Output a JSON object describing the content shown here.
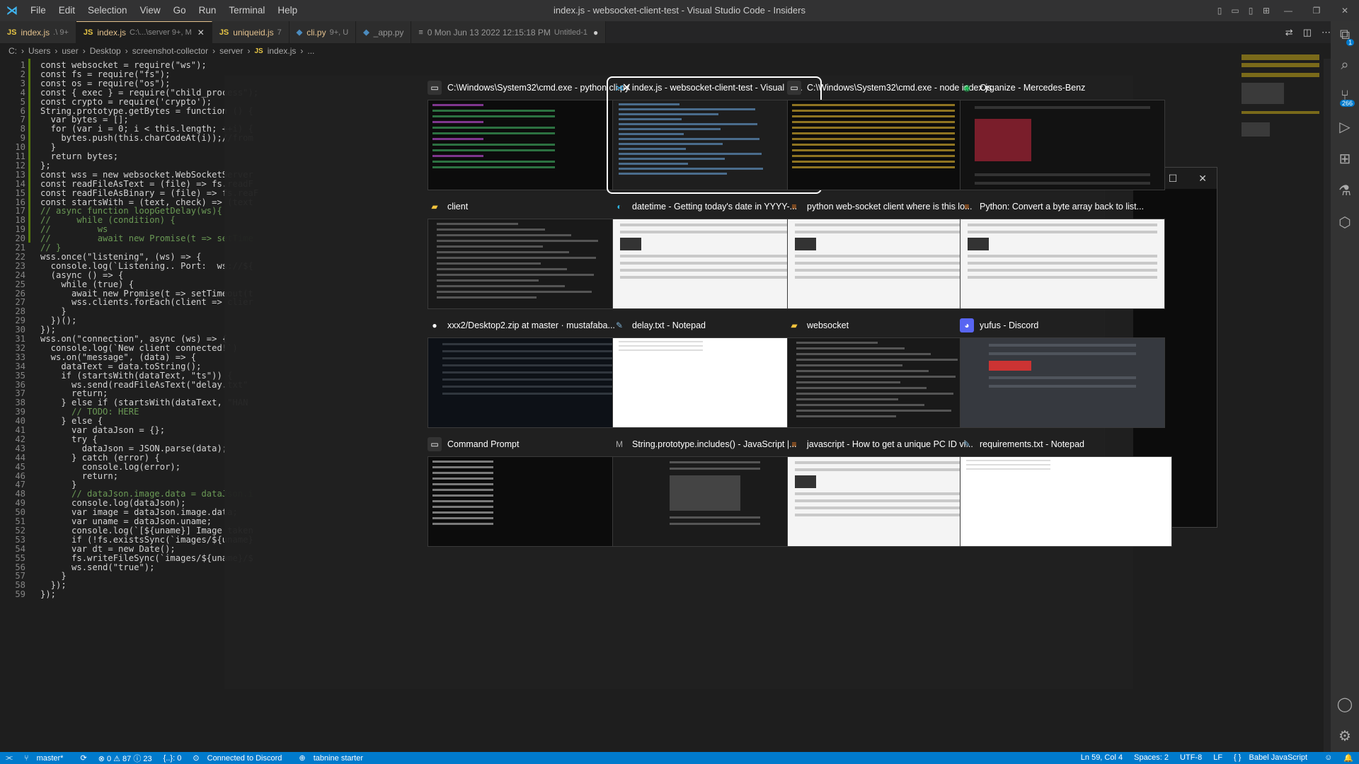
{
  "titlebar": {
    "menus": [
      "File",
      "Edit",
      "Selection",
      "View",
      "Go",
      "Run",
      "Terminal",
      "Help"
    ],
    "title": "index.js - websocket-client-test - Visual Studio Code - Insiders"
  },
  "tabs": [
    {
      "name": "index.js",
      "desc": ".\\ 9+",
      "active": false
    },
    {
      "name": "index.js",
      "desc": "C:\\...\\server 9+, M",
      "active": true
    },
    {
      "name": "uniqueid.js",
      "desc": "7",
      "active": false
    },
    {
      "name": "cli.py",
      "desc": "9+, U",
      "active": false
    },
    {
      "name": "_app.py",
      "desc": "",
      "active": false
    },
    {
      "name": "0 Mon Jun 13 2022 12:15:18 PM",
      "desc": "Untitled-1",
      "active": false
    }
  ],
  "breadcrumb": [
    "C:",
    "Users",
    "user",
    "Desktop",
    "screenshot-collector",
    "server",
    "index.js",
    "..."
  ],
  "code_lines": [
    "const websocket = require(\"ws\");",
    "const fs = require(\"fs\");",
    "const os = require(\"os\");",
    "const { exec } = require(\"child_process\");",
    "const crypto = require('crypto');",
    "String.prototype.getBytes = function () {",
    "  var bytes = [];",
    "  for (var i = 0; i < this.length; ++i) {",
    "    bytes.push(this.charCodeAt(i));//from",
    "  }",
    "  return bytes;",
    "};",
    "const wss = new websocket.WebSocketServer",
    "const readFileAsText = (file) => fs.readF",
    "const readFileAsBinary = (file) => fs.reaF",
    "const startsWith = (text, check) => (text",
    "// async function loopGetDelay(ws){",
    "//     while (condition) {",
    "//         ws",
    "//         await new Promise(t => setTime",
    "// }",
    "wss.once(\"listening\", (ws) => {",
    "  console.log(`Listening.. Port:  ws://${",
    "  (async () => {",
    "    while (true) {",
    "      await new Promise(t => setTimeout(t",
    "      wss.clients.forEach(client => clier",
    "    }",
    "  })();",
    "});",
    "wss.on(\"connection\", async (ws) => {",
    "  console.log(`New client connected!`)",
    "  ws.on(\"message\", (data) => {",
    "    dataText = data.toString();",
    "    if (startsWith(dataText, \"ts\")) {",
    "      ws.send(readFileAsText(\"delay.txt\"",
    "      return;",
    "    } else if (startsWith(dataText, \"HAN",
    "      // TODO: HERE",
    "    } else {",
    "      var dataJson = {};",
    "      try {",
    "        dataJson = JSON.parse(data);",
    "      } catch (error) {",
    "        console.log(error);",
    "        return;",
    "      }",
    "      // dataJson.image.data = dataJson.i",
    "      console.log(dataJson);",
    "      var image = dataJson.image.data;",
    "      var uname = dataJson.uname;",
    "      console.log(`[${uname}] Image taken",
    "      if (!fs.existsSync(`images/${uname}",
    "      var dt = new Date();",
    "      fs.writeFileSync(`images/${uname}/$",
    "      ws.send(\"true\");",
    "    }",
    "  });",
    "});"
  ],
  "switcher": [
    {
      "title": "C:\\Windows\\System32\\cmd.exe - python  cli.py",
      "icon": "cmd-icon",
      "thumb": "term",
      "selected": false,
      "close": true
    },
    {
      "title": "index.js - websocket-client-test - Visual St...",
      "icon": "vscode-icon",
      "thumb": "code",
      "selected": true
    },
    {
      "title": "C:\\Windows\\System32\\cmd.exe - node  index.js",
      "icon": "cmd-icon",
      "thumb": "termy"
    },
    {
      "title": "Organize - Mercedes-Benz",
      "icon": "spotify-icon",
      "thumb": "spot"
    },
    {
      "title": "client",
      "icon": "folder-icon",
      "thumb": "exp"
    },
    {
      "title": "datetime - Getting today's date in YYYY-...",
      "icon": "edge-icon",
      "thumb": "light"
    },
    {
      "title": "python web-socket client where is this lo...",
      "icon": "stackoverflow-icon",
      "thumb": "light"
    },
    {
      "title": "Python: Convert a byte array back to list...",
      "icon": "stackoverflow-icon",
      "thumb": "light"
    },
    {
      "title": "xxx2/Desktop2.zip at master · mustafaba...",
      "icon": "github-icon",
      "thumb": "gh"
    },
    {
      "title": "delay.txt - Notepad",
      "icon": "notepad-icon",
      "thumb": "white"
    },
    {
      "title": "websocket",
      "icon": "folder-icon",
      "thumb": "exp"
    },
    {
      "title": "yufus - Discord",
      "icon": "discord-icon",
      "thumb": "disc"
    },
    {
      "title": "Command Prompt",
      "icon": "cmd-icon",
      "thumb": "termw"
    },
    {
      "title": "String.prototype.includes() - JavaScript |...",
      "icon": "mdn-icon",
      "thumb": "mdn"
    },
    {
      "title": "javascript - How to get a unique PC ID vi...",
      "icon": "stackoverflow-icon",
      "thumb": "light"
    },
    {
      "title": "requirements.txt - Notepad",
      "icon": "notepad-icon",
      "thumb": "white"
    }
  ],
  "statusbar": {
    "branch": "master*",
    "problems": "⊗ 0 ⚠ 87 ⓘ 23",
    "braces": "{..}: 0",
    "discord": "Connected to Discord",
    "tabnine": "tabnine starter",
    "position": "Ln 59, Col 4",
    "spaces": "Spaces: 2",
    "encoding": "UTF-8",
    "eol": "LF",
    "language": "Babel JavaScript"
  },
  "activity_badges": {
    "accounts": "1",
    "scm": "266"
  }
}
